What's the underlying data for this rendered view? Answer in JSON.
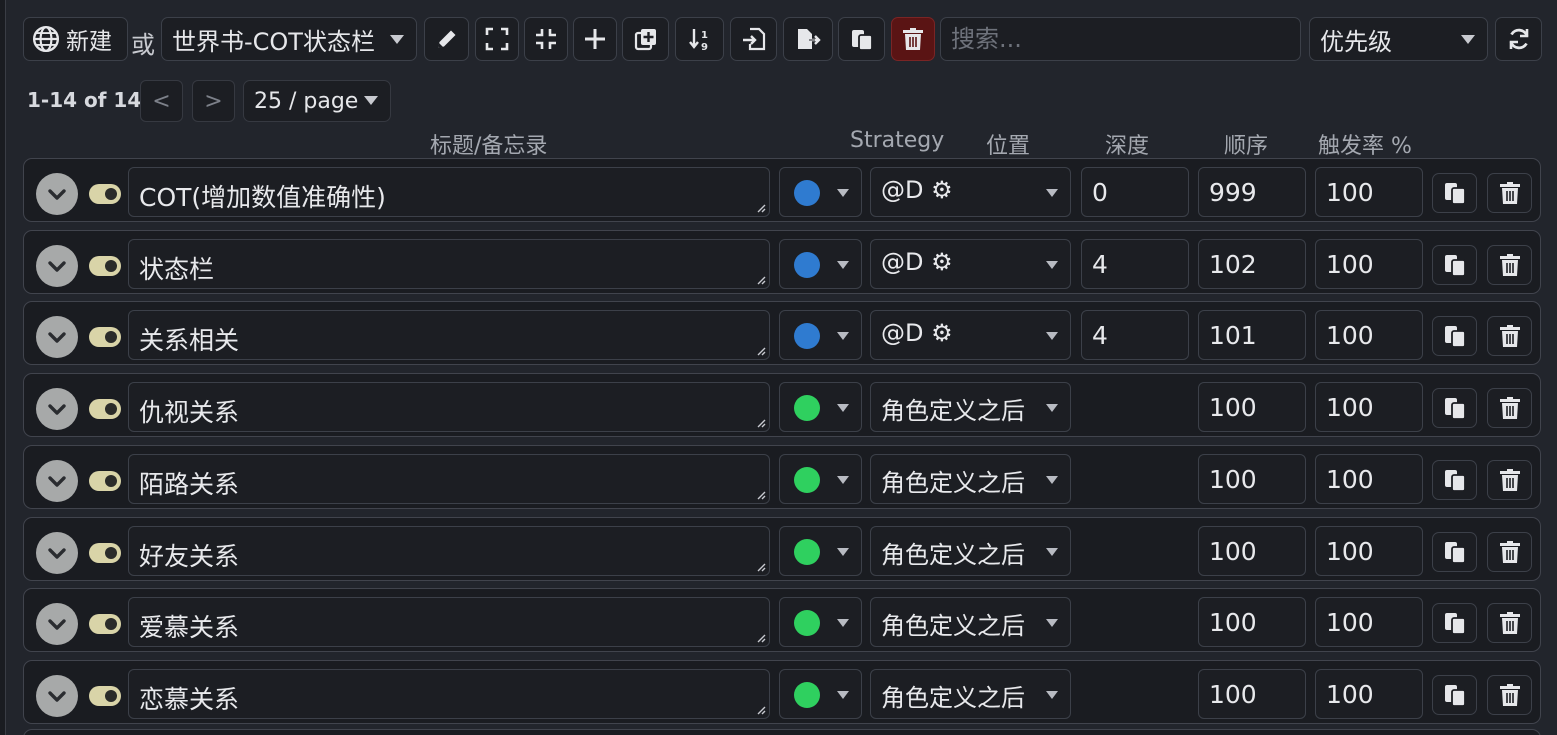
{
  "toolbar": {
    "new_label": "新建",
    "or_label": "或",
    "worldbook_select": "世界书-COT状态栏",
    "search_placeholder": "搜索...",
    "sort_select": "优先级"
  },
  "pager": {
    "range": "1-14 of 14",
    "prev": "<",
    "next": ">",
    "page_size": "25 / page"
  },
  "columns": {
    "title": "标题/备忘录",
    "strategy": "Strategy",
    "position": "位置",
    "depth": "深度",
    "order": "顺序",
    "probability": "触发率 %"
  },
  "colors": {
    "strategy_blue": "#2f7bd0",
    "strategy_green": "#2fd05f"
  },
  "entries": [
    {
      "title": "COT(增加数值准确性)",
      "strategy": "blue",
      "position": "@D ⚙",
      "depth": "0",
      "order": "999",
      "probability": "100"
    },
    {
      "title": "状态栏",
      "strategy": "blue",
      "position": "@D ⚙",
      "depth": "4",
      "order": "102",
      "probability": "100"
    },
    {
      "title": "关系相关",
      "strategy": "blue",
      "position": "@D ⚙",
      "depth": "4",
      "order": "101",
      "probability": "100"
    },
    {
      "title": "仇视关系",
      "strategy": "green",
      "position": "角色定义之后",
      "depth": "",
      "order": "100",
      "probability": "100"
    },
    {
      "title": "陌路关系",
      "strategy": "green",
      "position": "角色定义之后",
      "depth": "",
      "order": "100",
      "probability": "100"
    },
    {
      "title": "好友关系",
      "strategy": "green",
      "position": "角色定义之后",
      "depth": "",
      "order": "100",
      "probability": "100"
    },
    {
      "title": "爱慕关系",
      "strategy": "green",
      "position": "角色定义之后",
      "depth": "",
      "order": "100",
      "probability": "100"
    },
    {
      "title": "恋慕关系",
      "strategy": "green",
      "position": "角色定义之后",
      "depth": "",
      "order": "100",
      "probability": "100"
    }
  ]
}
